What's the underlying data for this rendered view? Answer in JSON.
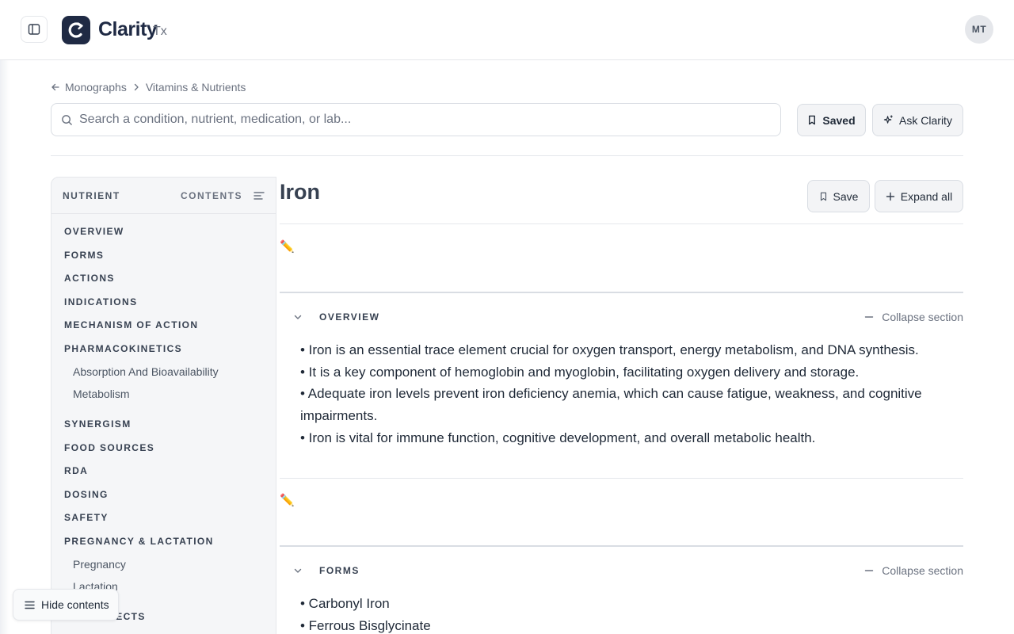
{
  "header": {
    "brand_name": "Clarity",
    "brand_suffix": "Tx",
    "avatar_initials": "MT"
  },
  "breadcrumb": {
    "items": [
      "Monographs",
      "Vitamins & Nutrients"
    ]
  },
  "search": {
    "placeholder": "Search a condition, nutrient, medication, or lab..."
  },
  "actions": {
    "saved_label": "Saved",
    "ask_label": "Ask Clarity"
  },
  "toc": {
    "header_left": "NUTRIENT",
    "header_right": "CONTENTS",
    "items": [
      {
        "label": "OVERVIEW"
      },
      {
        "label": "FORMS"
      },
      {
        "label": "ACTIONS"
      },
      {
        "label": "INDICATIONS"
      },
      {
        "label": "MECHANISM OF ACTION"
      },
      {
        "label": "PHARMACOKINETICS"
      },
      {
        "label": "Absorption And Bioavailability"
      },
      {
        "label": "Metabolism"
      },
      {
        "label": "SYNERGISM"
      },
      {
        "label": "FOOD SOURCES"
      },
      {
        "label": "RDA"
      },
      {
        "label": "DOSING"
      },
      {
        "label": "SAFETY"
      },
      {
        "label": "PREGNANCY & LACTATION"
      },
      {
        "label": "Pregnancy"
      },
      {
        "label": "Lactation"
      },
      {
        "label": "SIDE EFFECTS"
      }
    ],
    "hide_label": "Hide contents"
  },
  "main": {
    "title": "Iron",
    "save_label": "Save",
    "expand_label": "Expand all",
    "edit_glyph": "✏️",
    "sections": [
      {
        "label": "OVERVIEW",
        "collapse_label": "Collapse section",
        "bullets": [
          "• Iron is an essential trace element crucial for oxygen transport, energy metabolism, and DNA synthesis.",
          "• It is a key component of hemoglobin and myoglobin, facilitating oxygen delivery and storage.",
          "• Adequate iron levels prevent iron deficiency anemia, which can cause fatigue, weakness, and cognitive impairments.",
          "• Iron is vital for immune function, cognitive development, and overall metabolic health."
        ]
      },
      {
        "label": "FORMS",
        "collapse_label": "Collapse section",
        "bullets": [
          "• Carbonyl Iron",
          "• Ferrous Bisglycinate"
        ]
      }
    ]
  }
}
